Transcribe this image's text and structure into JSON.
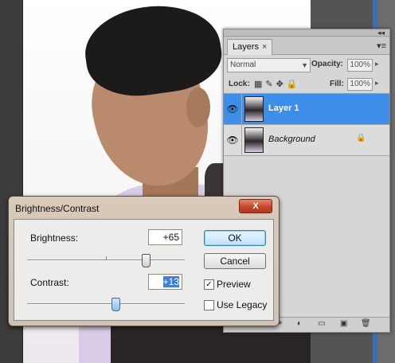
{
  "layers_panel": {
    "tab_label": "Layers",
    "tab_close": "×",
    "blend_mode": "Normal",
    "opacity_label": "Opacity:",
    "opacity_value": "100%",
    "lock_label": "Lock:",
    "fill_label": "Fill:",
    "fill_value": "100%",
    "layers": [
      {
        "name": "Layer 1",
        "selected": true,
        "visible": true
      },
      {
        "name": "Background",
        "selected": false,
        "visible": true,
        "locked": true
      }
    ]
  },
  "dialog": {
    "title": "Brightness/Contrast",
    "close_label": "X",
    "brightness_label": "Brightness:",
    "brightness_value": "+65",
    "brightness_level": 0.75,
    "contrast_label": "Contrast:",
    "contrast_value": "+13",
    "contrast_level": 0.56,
    "ok_label": "OK",
    "cancel_label": "Cancel",
    "preview_label": "Preview",
    "preview_checked": true,
    "legacy_label": "Use Legacy",
    "legacy_checked": false
  },
  "colors": {
    "selection": "#3d8ee8",
    "close_button": "#c6452a"
  }
}
